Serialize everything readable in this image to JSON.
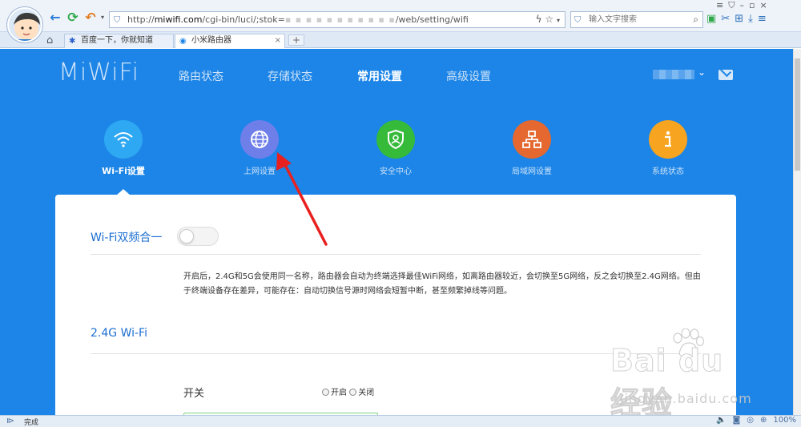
{
  "browser": {
    "url_prefix": "http://",
    "url_domain": "miwifi.com",
    "url_path": "/cgi-bin/luci/;stok=",
    "url_hidden": "▪ ▪ ▪ ▪ ▪ ▪ ▪ ▪ ▪ ▪ ▪",
    "url_suffix": "/web/setting/wifi",
    "search_placeholder": "输入文字搜索",
    "tabs": [
      {
        "label": "百度一下，你就知道",
        "icon": "baidu-paw-icon"
      },
      {
        "label": "小米路由器",
        "icon": "wifi-icon"
      }
    ],
    "new_tab": "+",
    "close": "×"
  },
  "app": {
    "logo": "MiWiFi",
    "nav": [
      {
        "label": "路由状态"
      },
      {
        "label": "存储状态"
      },
      {
        "label": "常用设置",
        "active": true
      },
      {
        "label": "高级设置"
      }
    ]
  },
  "categories": [
    {
      "label": "Wi-Fi设置",
      "color": "#2ea8f2",
      "icon": "wifi-icon",
      "active": true
    },
    {
      "label": "上网设置",
      "color": "#6e7fea",
      "icon": "globe-icon"
    },
    {
      "label": "安全中心",
      "color": "#35ba3a",
      "icon": "shield-user-icon"
    },
    {
      "label": "局域网设置",
      "color": "#e4682f",
      "icon": "network-icon"
    },
    {
      "label": "系统状态",
      "color": "#f7a420",
      "icon": "info-icon"
    }
  ],
  "card": {
    "dual_band_title": "Wi-Fi双频合一",
    "dual_band_desc": "开启后，2.4G和5G会使用同一名称，路由器会自动为终端选择最佳WiFi网络，如离路由器较近，会切换至5G网络，反之会切换至2.4G网络。但由于终端设备存在差异，可能存在：自动切换信号源时网络会短暂中断，甚至频繁掉线等问题。",
    "wifi24_title": "2.4G Wi-Fi",
    "switch_label": "开关",
    "radio_on": "开启",
    "radio_off": "关闭"
  },
  "watermark": {
    "brand": "Bai du 经验",
    "site": "jingyan.baidu.com"
  },
  "status": {
    "text": "完成",
    "zoom": "100%"
  },
  "colors": {
    "page_bg": "#1c85e7",
    "annotation_arrow": "#e8201f"
  }
}
